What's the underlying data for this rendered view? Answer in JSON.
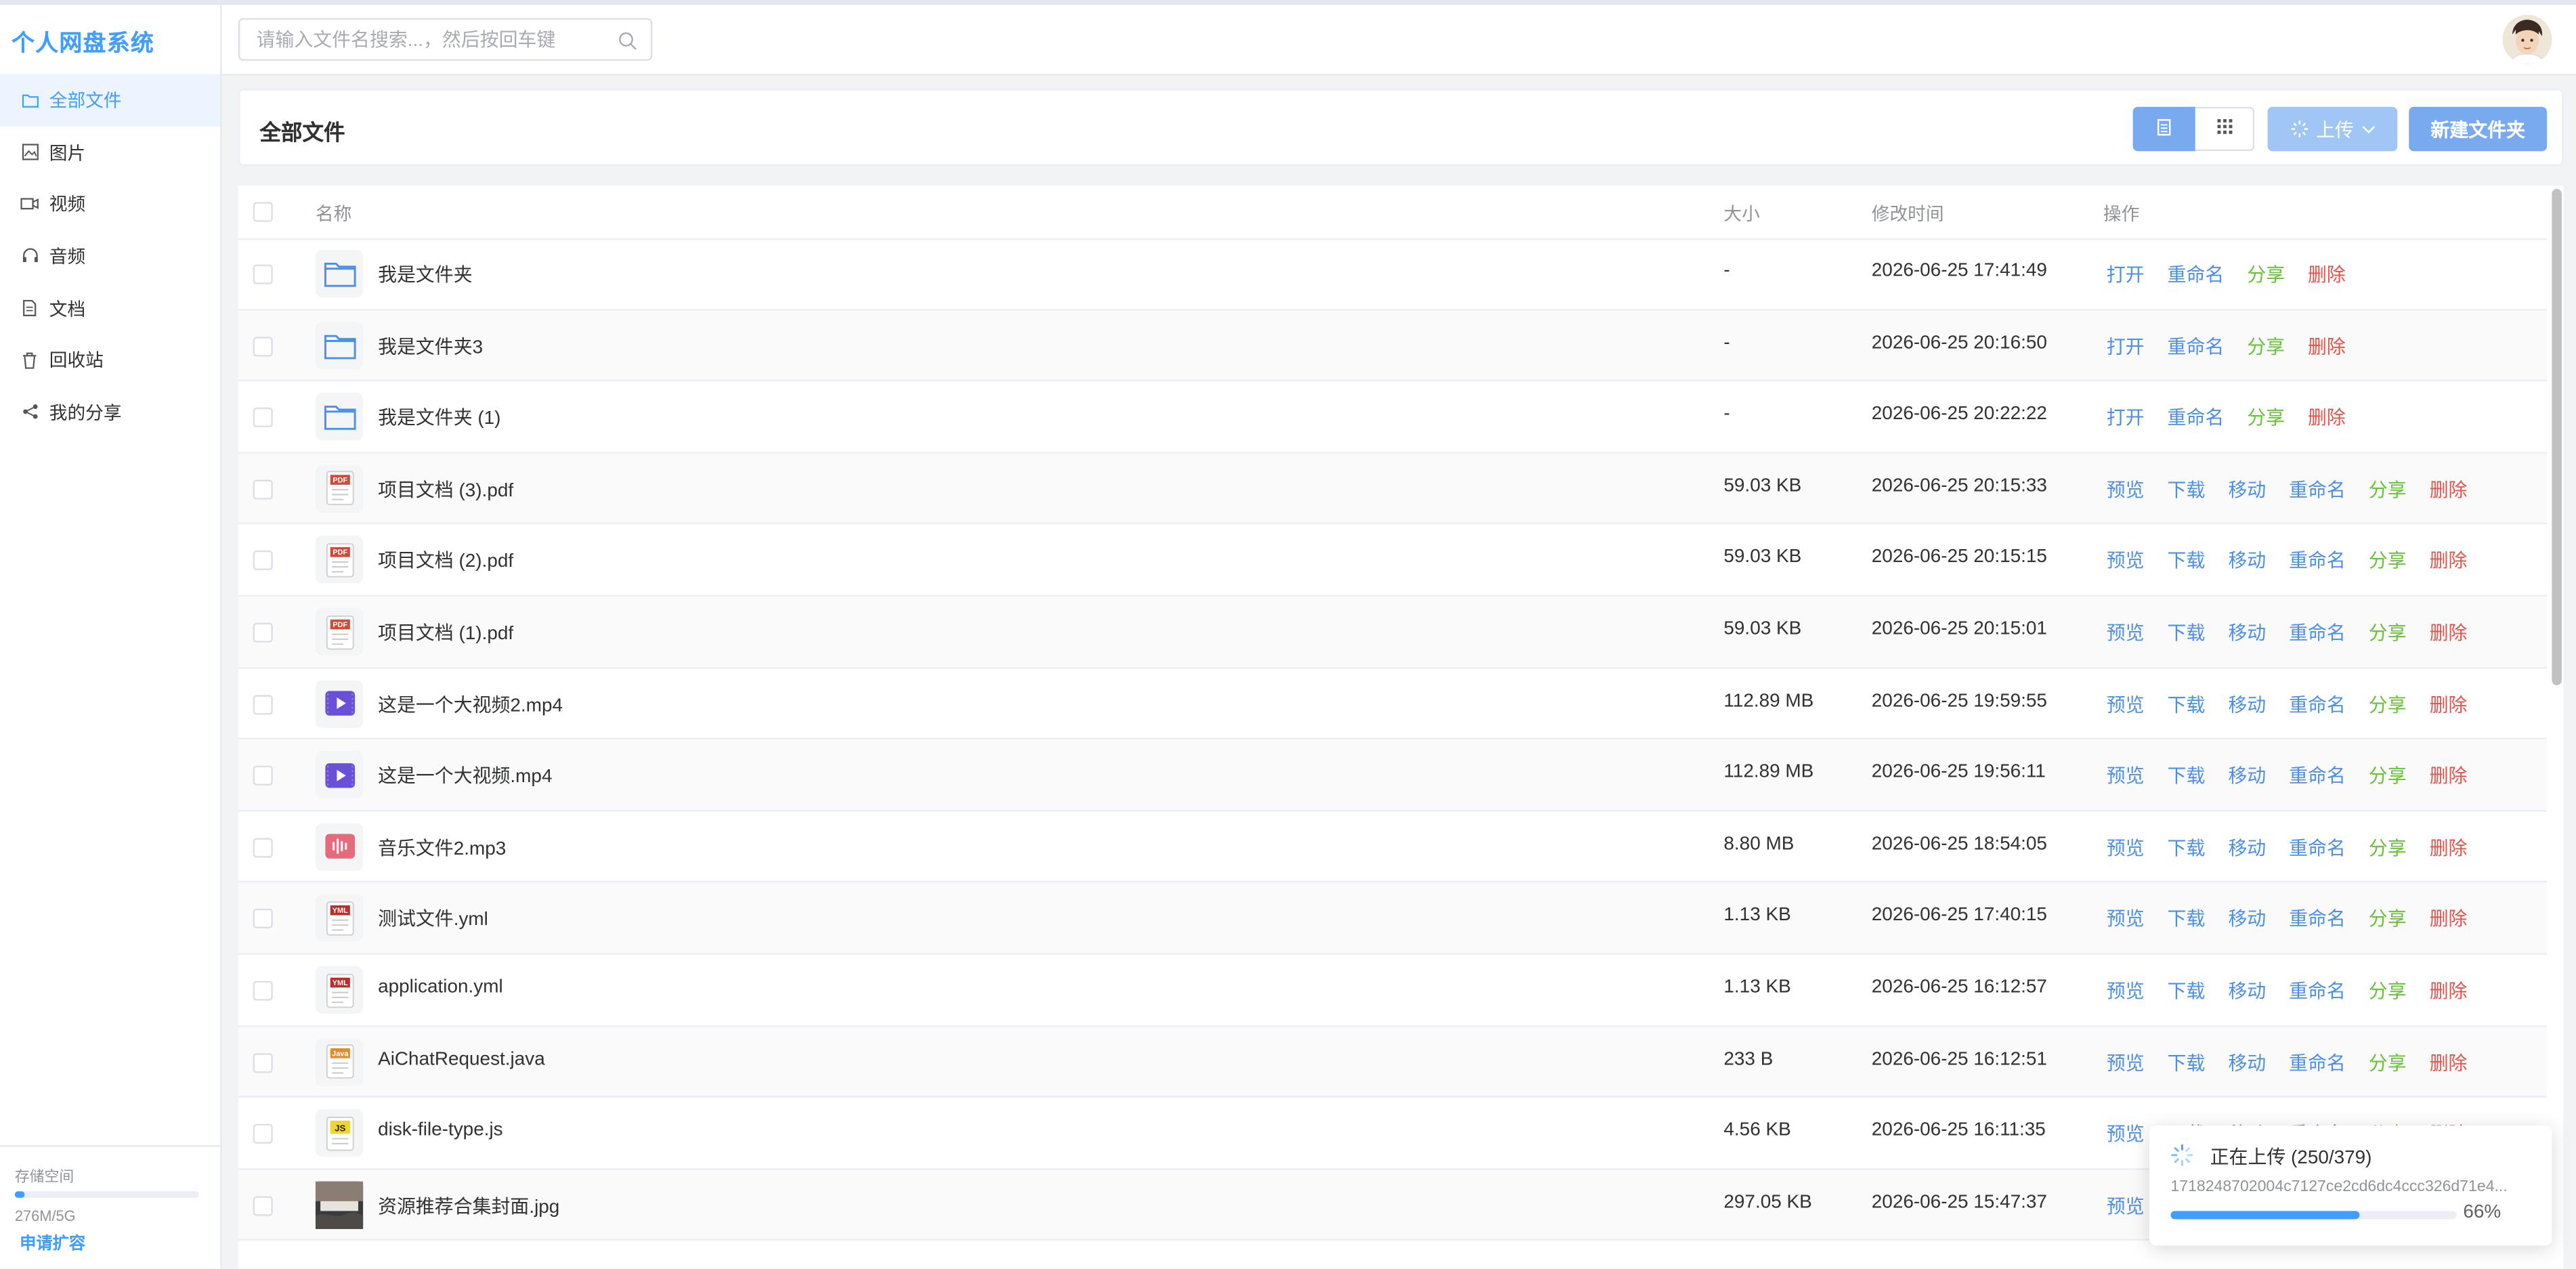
{
  "app": {
    "title": "个人网盘系统"
  },
  "sidebar": {
    "items": [
      {
        "label": "全部文件",
        "icon": "folder-icon",
        "active": true
      },
      {
        "label": "图片",
        "icon": "image-icon"
      },
      {
        "label": "视频",
        "icon": "video-icon"
      },
      {
        "label": "音频",
        "icon": "headphones-icon"
      },
      {
        "label": "文档",
        "icon": "document-icon"
      },
      {
        "label": "回收站",
        "icon": "trash-icon"
      },
      {
        "label": "我的分享",
        "icon": "share-icon"
      }
    ],
    "storage": {
      "label": "存储空间",
      "used_text": "276M/5G",
      "used_fraction": 0.054,
      "apply_label": "申请扩容"
    }
  },
  "header": {
    "search_placeholder": "请输入文件名搜索...，然后按回车键",
    "search_value": ""
  },
  "toolbar": {
    "title": "全部文件",
    "upload_label": "上传",
    "new_folder_label": "新建文件夹"
  },
  "table": {
    "columns": [
      "名称",
      "大小",
      "修改时间",
      "操作"
    ],
    "actions": {
      "open": "打开",
      "rename": "重命名",
      "share": "分享",
      "delete": "删除",
      "preview": "预览",
      "download": "下载",
      "move": "移动"
    },
    "rows": [
      {
        "name": "我是文件夹",
        "size": "-",
        "time": "2026-06-25 17:41:49",
        "type": "folder"
      },
      {
        "name": "我是文件夹3",
        "size": "-",
        "time": "2026-06-25 20:16:50",
        "type": "folder"
      },
      {
        "name": "我是文件夹 (1)",
        "size": "-",
        "time": "2026-06-25 20:22:22",
        "type": "folder"
      },
      {
        "name": "项目文档 (3).pdf",
        "size": "59.03 KB",
        "time": "2026-06-25 20:15:33",
        "type": "pdf"
      },
      {
        "name": "项目文档 (2).pdf",
        "size": "59.03 KB",
        "time": "2026-06-25 20:15:15",
        "type": "pdf"
      },
      {
        "name": "项目文档 (1).pdf",
        "size": "59.03 KB",
        "time": "2026-06-25 20:15:01",
        "type": "pdf"
      },
      {
        "name": "这是一个大视频2.mp4",
        "size": "112.89 MB",
        "time": "2026-06-25 19:59:55",
        "type": "video"
      },
      {
        "name": "这是一个大视频.mp4",
        "size": "112.89 MB",
        "time": "2026-06-25 19:56:11",
        "type": "video"
      },
      {
        "name": "音乐文件2.mp3",
        "size": "8.80 MB",
        "time": "2026-06-25 18:54:05",
        "type": "audio"
      },
      {
        "name": "测试文件.yml",
        "size": "1.13 KB",
        "time": "2026-06-25 17:40:15",
        "type": "yml"
      },
      {
        "name": "application.yml",
        "size": "1.13 KB",
        "time": "2026-06-25 16:12:57",
        "type": "yml"
      },
      {
        "name": "AiChatRequest.java",
        "size": "233 B",
        "time": "2026-06-25 16:12:51",
        "type": "java"
      },
      {
        "name": "disk-file-type.js",
        "size": "4.56 KB",
        "time": "2026-06-25 16:11:35",
        "type": "js"
      },
      {
        "name": "资源推荐合集封面.jpg",
        "size": "297.05 KB",
        "time": "2026-06-25 15:47:37",
        "type": "image"
      }
    ]
  },
  "upload_popup": {
    "title": "正在上传 (250/379)",
    "filename": "1718248702004c7127ce2cd6dc4ccc326d71e4...",
    "percent_text": "66%",
    "progress": 0.66
  },
  "icon_badges": {
    "pdf": "PDF",
    "yml": "YML",
    "java": "Java",
    "js": "JS"
  },
  "colors": {
    "accent": "#409eff",
    "share": "#67c23a",
    "delete": "#e5534b",
    "link": "#4c8fea"
  }
}
